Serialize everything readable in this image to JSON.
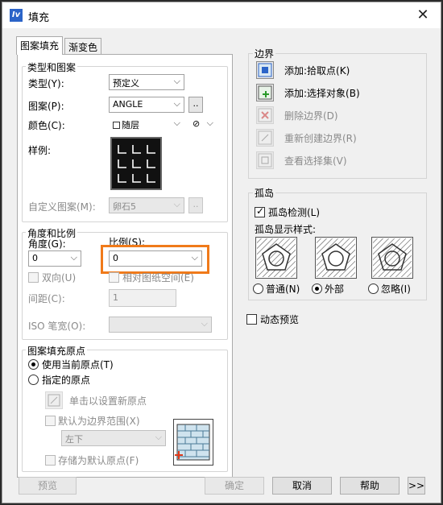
{
  "window": {
    "title": "填充",
    "app_icon_text": "Iv"
  },
  "tabs": [
    {
      "label": "图案填充",
      "active": true
    },
    {
      "label": "渐变色",
      "active": false
    }
  ],
  "type_pattern": {
    "group_label": "类型和图案",
    "type_label": "类型(Y):",
    "type_value": "预定义",
    "pattern_label": "图案(P):",
    "pattern_value": "ANGLE",
    "pattern_browse": "..",
    "color_label": "颜色(C):",
    "color_value": "随层",
    "color2_value": "⊘",
    "sample_label": "样例:",
    "custom_label": "自定义图案(M):",
    "custom_value": "卵石5",
    "custom_browse": ".."
  },
  "angle_scale": {
    "group_label": "角度和比例",
    "angle_label": "角度(G):",
    "angle_value": "0",
    "scale_label": "比例(S):",
    "scale_value": "0",
    "bidirectional_label": "双向(U)",
    "relative_label": "相对图纸空间(E)",
    "spacing_label": "间距(C):",
    "spacing_value": "1",
    "iso_label": "ISO 笔宽(O):",
    "iso_value": ""
  },
  "origin": {
    "group_label": "图案填充原点",
    "use_current_label": "使用当前原点(T)",
    "specified_label": "指定的原点",
    "click_set_label": "单击以设置新原点",
    "default_boundary_label": "默认为边界范围(X)",
    "position_value": "左下",
    "store_default_label": "存储为默认原点(F)"
  },
  "boundary": {
    "group_label": "边界",
    "add_pick_label": "添加:拾取点(K)",
    "add_select_label": "添加:选择对象(B)",
    "remove_label": "删除边界(D)",
    "recreate_label": "重新创建边界(R)",
    "view_label": "查看选择集(V)"
  },
  "island": {
    "group_label": "孤岛",
    "detect_label": "孤岛检测(L)",
    "style_label": "孤岛显示样式:",
    "normal_label": "普通(N)",
    "outer_label": "外部",
    "ignore_label": "忽略(I)"
  },
  "dynamic_preview_label": "动态预览",
  "buttons": {
    "preview": "预览",
    "ok": "确定",
    "cancel": "取消",
    "help": "帮助",
    "more": ">>"
  },
  "colors": {
    "highlight": "#f07a1a",
    "accent": "#2b64c8"
  }
}
